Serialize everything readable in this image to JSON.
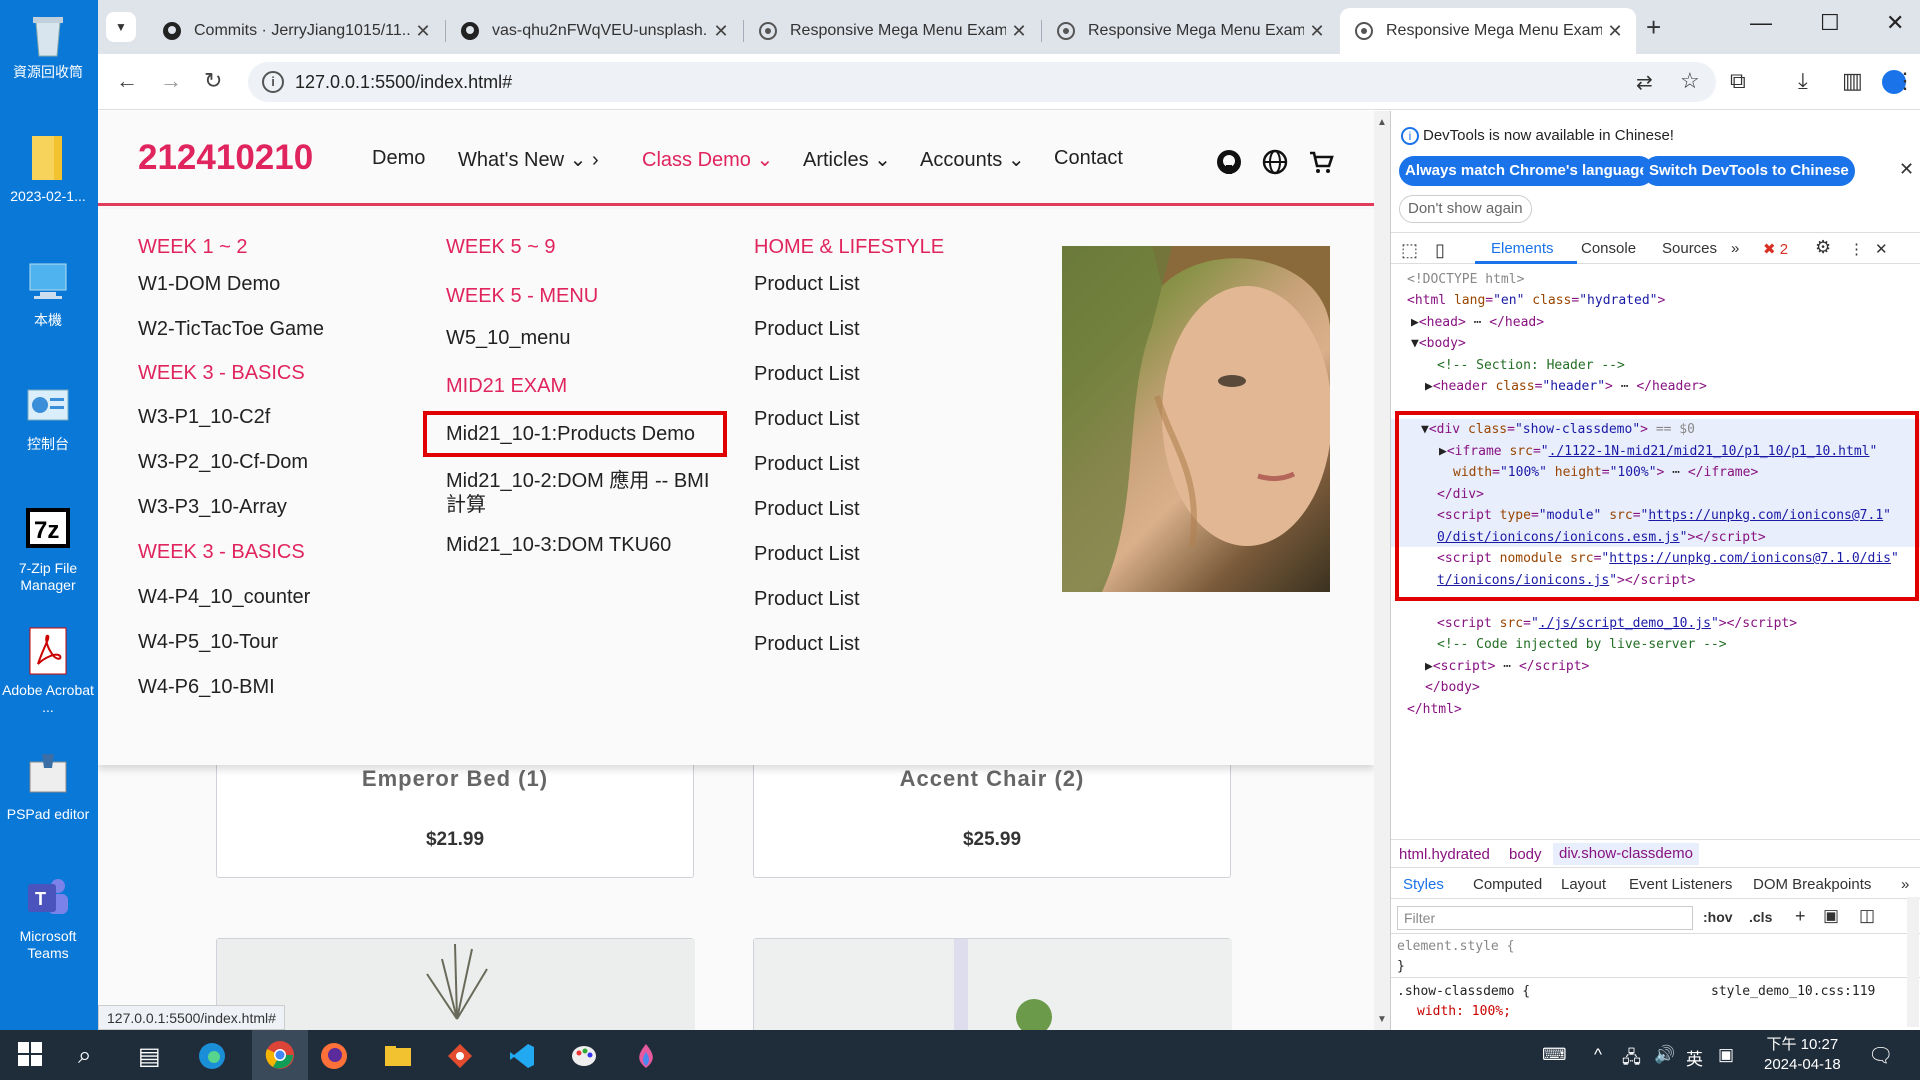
{
  "desktop": {
    "icons": [
      {
        "label": "資源回收筒"
      },
      {
        "label": "2023-02-1..."
      },
      {
        "label": "本機"
      },
      {
        "label": "控制台"
      },
      {
        "label": "7-Zip File Manager"
      },
      {
        "label": "Adobe Acrobat ..."
      },
      {
        "label": "PSPad editor"
      },
      {
        "label": "Microsoft Teams"
      }
    ]
  },
  "browser": {
    "tabs": [
      {
        "title": "Commits · JerryJiang1015/11..."
      },
      {
        "title": "vas-qhu2nFWqVEU-unsplash..."
      },
      {
        "title": "Responsive Mega Menu Exam..."
      },
      {
        "title": "Responsive Mega Menu Exam..."
      },
      {
        "title": "Responsive Mega Menu Exam..."
      }
    ],
    "url": "127.0.0.1:5500/index.html#",
    "status_url": "127.0.0.1:5500/index.html#"
  },
  "page": {
    "logo": "212410210",
    "nav": [
      {
        "label": "Demo"
      },
      {
        "label": "What's New"
      },
      {
        "label": "Class Demo"
      },
      {
        "label": "Articles"
      },
      {
        "label": "Accounts"
      },
      {
        "label": "Contact"
      }
    ],
    "mega": {
      "col1": {
        "h1": "WEEK 1 ~ 2",
        "items1": [
          "W1-DOM Demo",
          "W2-TicTacToe Game"
        ],
        "h2": "WEEK 3 - BASICS",
        "items2": [
          "W3-P1_10-C2f",
          "W3-P2_10-Cf-Dom",
          "W3-P3_10-Array"
        ],
        "h3": "WEEK 3 - BASICS",
        "items3": [
          "W4-P4_10_counter",
          "W4-P5_10-Tour",
          "W4-P6_10-BMI"
        ]
      },
      "col2": {
        "h1": "WEEK 5 ~ 9",
        "h2": "WEEK 5 - MENU",
        "items2": [
          "W5_10_menu"
        ],
        "h3": "MID21 EXAM",
        "items3": [
          "Mid21_10-1:Products Demo",
          "Mid21_10-2:DOM 應用 -- BMI",
          "計算",
          "Mid21_10-3:DOM TKU60"
        ]
      },
      "col3": {
        "h1": "HOME & LIFESTYLE",
        "items": [
          "Product List",
          "Product List",
          "Product List",
          "Product List",
          "Product List",
          "Product List",
          "Product List",
          "Product List",
          "Product List"
        ]
      }
    },
    "products": [
      {
        "name": "Emperor Bed (1)",
        "price": "$21.99"
      },
      {
        "name": "Accent Chair (2)",
        "price": "$25.99"
      }
    ]
  },
  "devtools": {
    "notice": "DevTools is now available in Chinese!",
    "btn_match": "Always match Chrome's language",
    "btn_switch": "Switch DevTools to Chinese",
    "btn_dont": "Don't show again",
    "tabs": [
      "Elements",
      "Console",
      "Sources"
    ],
    "error_count": "2",
    "breadcrumbs": [
      "html.hydrated",
      "body",
      "div.show-classdemo"
    ],
    "style_tabs": [
      "Styles",
      "Computed",
      "Layout",
      "Event Listeners",
      "DOM Breakpoints"
    ],
    "filter_placeholder": "Filter",
    "hov": ":hov",
    "cls": ".cls",
    "element_style": "element.style {",
    "close_brace": "}",
    "rule_selector": ".show-classdemo {",
    "rule_source": "style_demo_10.css:119",
    "rule_prop": "width: 100%;"
  },
  "taskbar": {
    "time": "下午 10:27",
    "date": "2024-04-18",
    "ime": "英"
  }
}
